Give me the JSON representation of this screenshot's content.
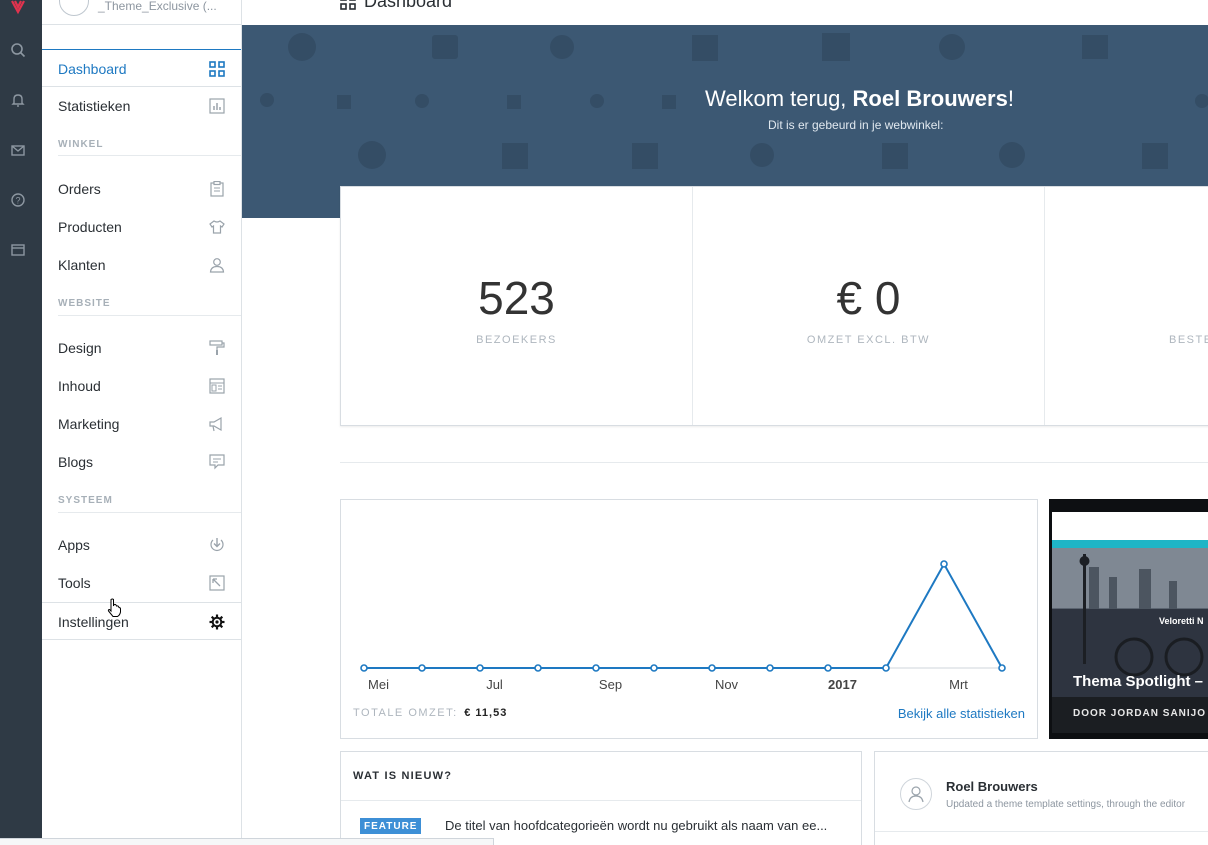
{
  "account": {
    "name": "_Theme_Exclusive (..."
  },
  "page_title": "Dashboard",
  "rail": {
    "icons": [
      "logo-icon",
      "search-icon",
      "bell-icon",
      "mail-icon",
      "help-icon",
      "window-icon"
    ]
  },
  "sidebar": {
    "dashboard": "Dashboard",
    "statistieken": "Statistieken",
    "section_winkel": "WINKEL",
    "orders": "Orders",
    "producten": "Producten",
    "klanten": "Klanten",
    "section_website": "WEBSITE",
    "design": "Design",
    "inhoud": "Inhoud",
    "marketing": "Marketing",
    "blogs": "Blogs",
    "section_systeem": "SYSTEEM",
    "apps": "Apps",
    "tools": "Tools",
    "instellingen": "Instellingen"
  },
  "hero": {
    "greeting": "Welkom terug, ",
    "name": "Roel Brouwers",
    "exclaim": "!",
    "subtitle": "Dit is er gebeurd in je webwinkel:"
  },
  "stats": [
    {
      "value": "523",
      "label": "BEZOEKERS"
    },
    {
      "value": "€ 0",
      "label": "OMZET EXCL. BTW"
    },
    {
      "value": "",
      "label": "BESTE"
    }
  ],
  "chart_data": {
    "type": "line",
    "x_labels": [
      "Mei",
      "Jul",
      "Sep",
      "Nov",
      "2017",
      "Mrt"
    ],
    "values": [
      0,
      0,
      0,
      0,
      0,
      0,
      0,
      0,
      0,
      0,
      11.53,
      0
    ],
    "ylim": [
      0,
      11.53
    ],
    "color": "#1e79c2"
  },
  "chart": {
    "total_label": "TOTALE OMZET:",
    "total_value": "€ 11,53",
    "link": "Bekijk alle statistieken"
  },
  "spotlight": {
    "title": "Thema Spotlight – E",
    "author": "DOOR JORDAN SANIJO",
    "caption": "Veloretti N"
  },
  "news": {
    "heading": "WAT IS NIEUW?",
    "badge": "FEATURE",
    "text": "De titel van hoofdcategorieën wordt nu gebruikt als naam van ee..."
  },
  "activity": {
    "name": "Roel Brouwers",
    "text": "Updated a theme template settings, through the editor"
  },
  "colors": {
    "accent": "#1e79c2",
    "rail": "#2f3a45",
    "hero": "#3c5873",
    "badge": "#3d8fd6"
  }
}
